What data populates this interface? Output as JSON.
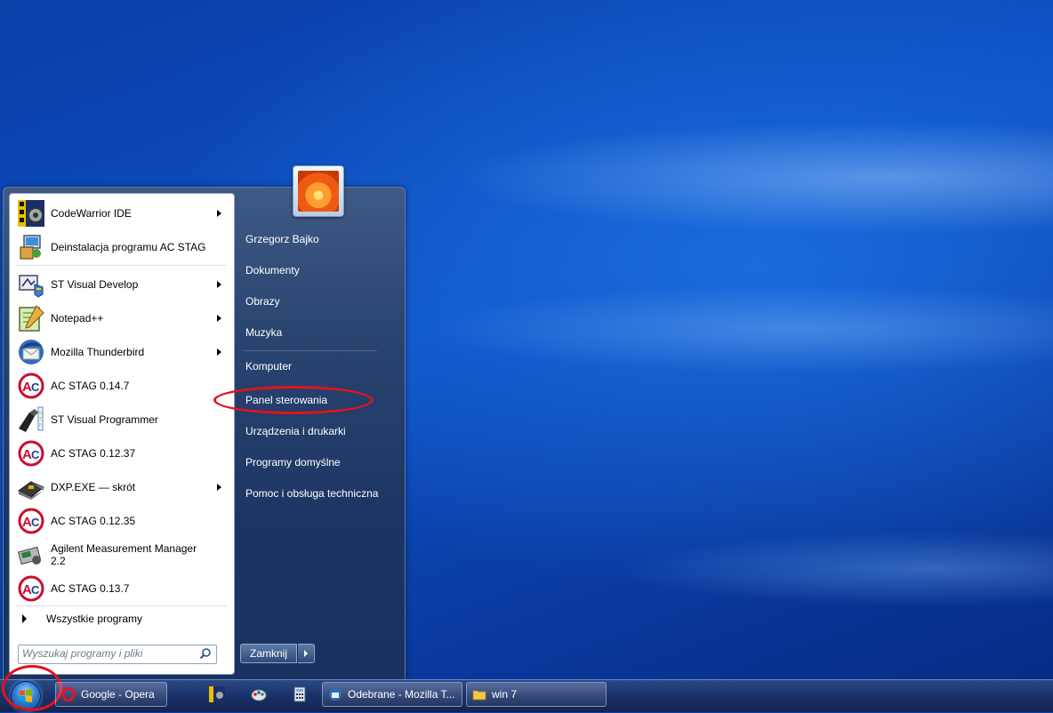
{
  "start_menu": {
    "programs": [
      {
        "label": "CodeWarrior IDE",
        "icon": "codewarrior-icon",
        "has_submenu": true
      },
      {
        "label": "Deinstalacja programu AC STAG",
        "icon": "uninstall-icon",
        "has_submenu": false
      },
      {
        "label": "ST Visual Develop",
        "icon": "st-visual-develop-icon",
        "has_submenu": true
      },
      {
        "label": "Notepad++",
        "icon": "notepad-plus-plus-icon",
        "has_submenu": true
      },
      {
        "label": "Mozilla Thunderbird",
        "icon": "thunderbird-icon",
        "has_submenu": true
      },
      {
        "label": "AC STAG 0.14.7",
        "icon": "ac-stag-icon",
        "has_submenu": false
      },
      {
        "label": "ST Visual Programmer",
        "icon": "st-visual-programmer-icon",
        "has_submenu": false
      },
      {
        "label": "AC STAG 0.12.37",
        "icon": "ac-stag-icon",
        "has_submenu": false
      },
      {
        "label": "DXP.EXE — skrót",
        "icon": "dxp-icon",
        "has_submenu": true
      },
      {
        "label": "AC STAG 0.12.35",
        "icon": "ac-stag-icon",
        "has_submenu": false
      },
      {
        "label": "Agilent Measurement Manager 2.2",
        "icon": "agilent-icon",
        "has_submenu": false
      },
      {
        "label": "AC STAG 0.13.7",
        "icon": "ac-stag-icon",
        "has_submenu": false
      }
    ],
    "all_programs_label": "Wszystkie programy",
    "search_placeholder": "Wyszukaj programy i pliki",
    "right_items": [
      {
        "label": "Grzegorz Bajko"
      },
      {
        "label": "Dokumenty"
      },
      {
        "label": "Obrazy"
      },
      {
        "label": "Muzyka"
      },
      {
        "label": "Komputer"
      },
      {
        "label": "Panel sterowania",
        "highlighted": true
      },
      {
        "label": "Urządzenia i drukarki"
      },
      {
        "label": "Programy domyślne"
      },
      {
        "label": "Pomoc i obsługa techniczna"
      }
    ],
    "shutdown_label": "Zamknij"
  },
  "taskbar": {
    "buttons": [
      {
        "label": "Google - Opera",
        "icon": "opera-icon"
      },
      {
        "label": "Odebrane - Mozilla T...",
        "icon": "thunderbird-icon"
      },
      {
        "label": "win 7",
        "icon": "folder-icon"
      }
    ],
    "quick_launch": [
      "codewarrior-icon",
      "paint-icon",
      "calculator-icon"
    ]
  },
  "colors": {
    "annotation_red": "#e3121c",
    "menu_right_pane": "#1c3462",
    "taskbar": "#1a3168"
  }
}
